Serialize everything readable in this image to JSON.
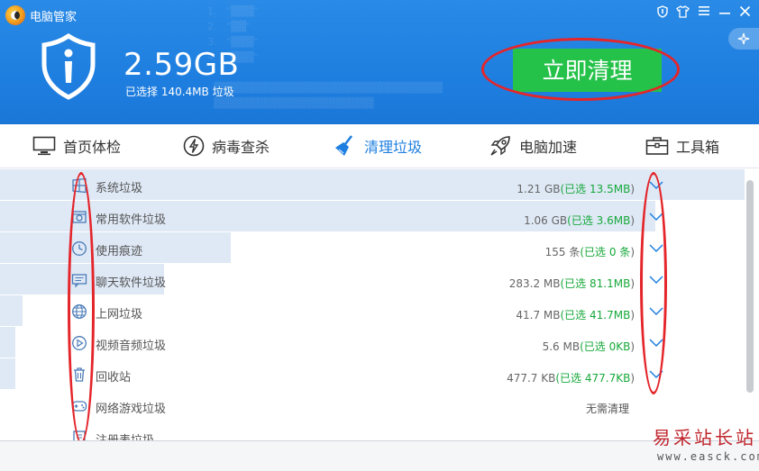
{
  "window": {
    "title": "电脑管家",
    "controls": [
      "shield-icon",
      "shirt-icon",
      "menu-icon",
      "minimize-icon",
      "close-icon"
    ]
  },
  "summary": {
    "total_size": "2.59GB",
    "selected_text": "已选择 140.4MB 垃圾",
    "clean_button": "立即清理"
  },
  "nav": {
    "items": [
      {
        "label": "首页体检",
        "icon": "monitor-icon",
        "active": false
      },
      {
        "label": "病毒查杀",
        "icon": "lightning-icon",
        "active": false
      },
      {
        "label": "清理垃圾",
        "icon": "broom-icon",
        "active": true
      },
      {
        "label": "电脑加速",
        "icon": "rocket-icon",
        "active": false
      },
      {
        "label": "工具箱",
        "icon": "toolbox-icon",
        "active": false
      }
    ]
  },
  "junk_list": [
    {
      "name": "系统垃圾",
      "size": "1.21 GB",
      "selected": "13.5MB",
      "icon": "windows-icon",
      "progress": 1.0
    },
    {
      "name": "常用软件垃圾",
      "size": "1.06 GB",
      "selected": "3.6MB",
      "icon": "software-icon",
      "progress": 0.88
    },
    {
      "name": "使用痕迹",
      "size": "155 条",
      "selected": "0 条",
      "icon": "clock-icon",
      "progress": 0.31
    },
    {
      "name": "聊天软件垃圾",
      "size": "283.2 MB",
      "selected": "81.1MB",
      "icon": "chat-icon",
      "progress": 0.22
    },
    {
      "name": "上网垃圾",
      "size": "41.7 MB",
      "selected": "41.7MB",
      "icon": "globe-icon",
      "progress": 0.03
    },
    {
      "name": "视频音频垃圾",
      "size": "5.6 MB",
      "selected": "0KB",
      "icon": "play-icon",
      "progress": 0.02
    },
    {
      "name": "回收站",
      "size": "477.7 KB",
      "selected": "477.7KB",
      "icon": "trash-icon",
      "progress": 0.02
    },
    {
      "name": "网络游戏垃圾",
      "status": "无需清理",
      "icon": "gamepad-icon",
      "progress": 0
    },
    {
      "name": "注册表垃圾",
      "icon": "registry-icon",
      "progress": 0
    }
  ],
  "labels": {
    "selected_prefix": "(已选 ",
    "selected_suffix": ")"
  },
  "watermark": {
    "cn": "易采站长站",
    "url": "www.easck.com"
  },
  "colors": {
    "header_blue": "#1f7fe0",
    "clean_green": "#25c24a",
    "selected_green": "#17a83a",
    "annotation_red": "#e4252a"
  }
}
